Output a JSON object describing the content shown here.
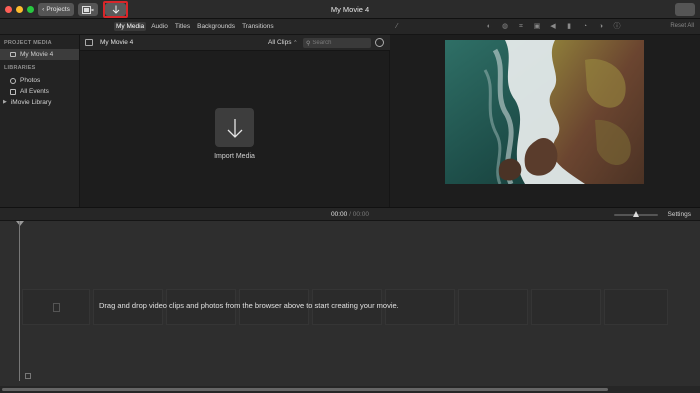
{
  "window": {
    "title": "My Movie 4",
    "projects_label": "Projects"
  },
  "tabs": [
    {
      "label": "My Media",
      "active": true
    },
    {
      "label": "Audio"
    },
    {
      "label": "Titles"
    },
    {
      "label": "Backgrounds"
    },
    {
      "label": "Transitions"
    }
  ],
  "viewer_tools": {
    "icons": [
      "magic-wand-icon",
      "color-balance-icon",
      "color-correction-icon",
      "crop-icon",
      "stabilization-icon",
      "volume-icon",
      "noise-reduction-icon",
      "speed-icon",
      "filter-icon",
      "info-icon"
    ],
    "reset_all": "Reset All"
  },
  "sidebar": {
    "project_media_heading": "PROJECT MEDIA",
    "project_item": "My Movie 4",
    "libraries_heading": "LIBRARIES",
    "library_items": [
      "Photos",
      "All Events",
      "iMovie Library"
    ]
  },
  "browser": {
    "title": "My Movie 4",
    "filter": "All Clips",
    "search_placeholder": "Search",
    "import_label": "Import Media"
  },
  "timeline": {
    "current_time": "00:00",
    "separator": "/",
    "total_time": "00:00",
    "settings_label": "Settings",
    "drop_hint": "Drag and drop video clips and photos from the browser above to start creating your movie."
  },
  "colors": {
    "close": "#ff5f57",
    "minimize": "#febc2e",
    "zoom": "#28c840",
    "highlight": "#d7262a"
  }
}
